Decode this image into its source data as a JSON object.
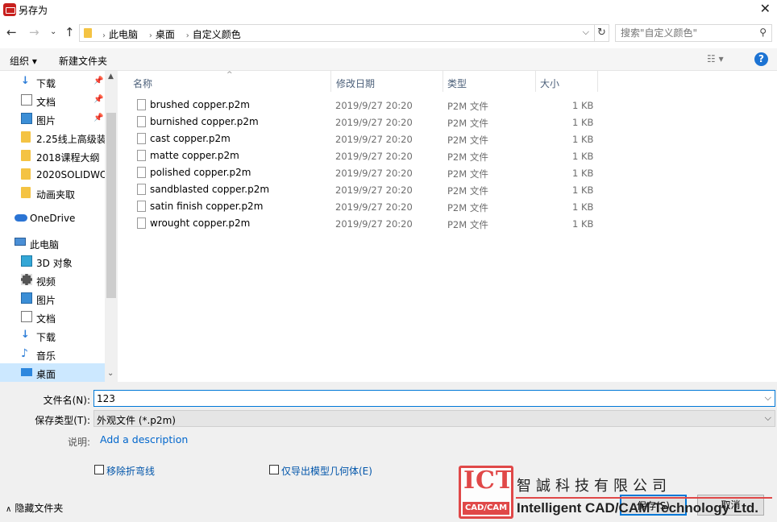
{
  "window": {
    "title": "另存为",
    "close_symbol": "✕"
  },
  "address": {
    "crumbs": [
      "此电脑",
      "桌面",
      "自定义颜色"
    ],
    "search_placeholder": "搜索\"自定义颜色\""
  },
  "toolbar": {
    "organize": "组织 ▾",
    "new_folder": "新建文件夹",
    "help": "?"
  },
  "sidebar": {
    "items": [
      {
        "label": "下载",
        "icon": "download-icon",
        "pinned": true
      },
      {
        "label": "文档",
        "icon": "document-icon",
        "pinned": true
      },
      {
        "label": "图片",
        "icon": "picture-icon",
        "pinned": true
      },
      {
        "label": "2.25线上高级装",
        "icon": "folder-icon"
      },
      {
        "label": "2018课程大纲",
        "icon": "folder-icon"
      },
      {
        "label": "2020SOLIDWO",
        "icon": "folder-icon"
      },
      {
        "label": "动画夹取",
        "icon": "folder-icon"
      },
      {
        "label": "OneDrive",
        "icon": "cloud-icon"
      },
      {
        "label": "此电脑",
        "icon": "computer-icon"
      },
      {
        "label": "3D 对象",
        "icon": "3d-objects-icon"
      },
      {
        "label": "视频",
        "icon": "video-icon"
      },
      {
        "label": "图片",
        "icon": "picture-icon"
      },
      {
        "label": "文档",
        "icon": "document-icon"
      },
      {
        "label": "下载",
        "icon": "download-icon"
      },
      {
        "label": "音乐",
        "icon": "music-icon"
      },
      {
        "label": "桌面",
        "icon": "desktop-icon",
        "selected": true
      }
    ]
  },
  "columns": {
    "name": "名称",
    "modified": "修改日期",
    "type": "类型",
    "size": "大小"
  },
  "files": [
    {
      "name": "brushed copper.p2m",
      "modified": "2019/9/27 20:20",
      "type": "P2M 文件",
      "size": "1 KB"
    },
    {
      "name": "burnished copper.p2m",
      "modified": "2019/9/27 20:20",
      "type": "P2M 文件",
      "size": "1 KB"
    },
    {
      "name": "cast copper.p2m",
      "modified": "2019/9/27 20:20",
      "type": "P2M 文件",
      "size": "1 KB"
    },
    {
      "name": "matte copper.p2m",
      "modified": "2019/9/27 20:20",
      "type": "P2M 文件",
      "size": "1 KB"
    },
    {
      "name": "polished copper.p2m",
      "modified": "2019/9/27 20:20",
      "type": "P2M 文件",
      "size": "1 KB"
    },
    {
      "name": "sandblasted copper.p2m",
      "modified": "2019/9/27 20:20",
      "type": "P2M 文件",
      "size": "1 KB"
    },
    {
      "name": "satin finish copper.p2m",
      "modified": "2019/9/27 20:20",
      "type": "P2M 文件",
      "size": "1 KB"
    },
    {
      "name": "wrought copper.p2m",
      "modified": "2019/9/27 20:20",
      "type": "P2M 文件",
      "size": "1 KB"
    }
  ],
  "form": {
    "filename_label": "文件名(N):",
    "filename_value": "123",
    "filetype_label": "保存类型(T):",
    "filetype_value": "外观文件 (*.p2m)",
    "description_label": "说明:",
    "description_link": "Add a description",
    "option1": "移除折弯线",
    "option2": "仅导出模型几何体(E)",
    "hide_folders": "隐藏文件夹",
    "save": "保存(S)",
    "cancel": "取消"
  },
  "watermark": {
    "logo_letters": "ICT",
    "logo_sub": "CAD/CAM",
    "company_cn": "智誠科技有限公司",
    "company_en": "Intelligent CAD/CAM Technology Ltd."
  },
  "colors": {
    "accent": "#0078d7",
    "selection": "#cce8ff",
    "link": "#0066cc",
    "watermark_red": "#e04848"
  }
}
